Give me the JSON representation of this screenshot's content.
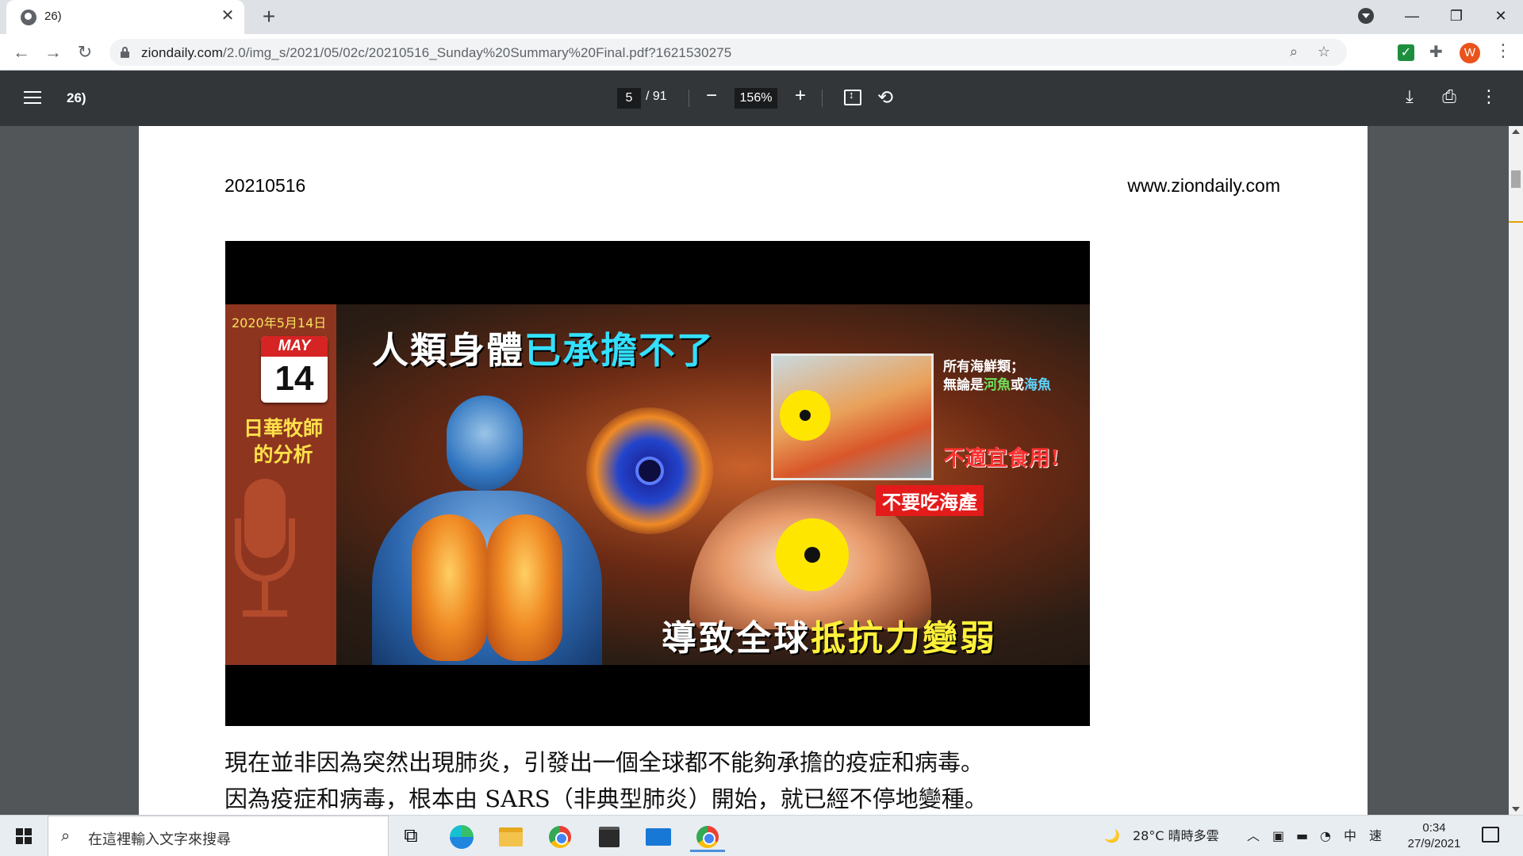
{
  "browser": {
    "tab_title": "26)",
    "tab_close": "✕",
    "new_tab": "+",
    "url_host": "ziondaily.com",
    "url_path": "/2.0/img_s/2021/05/02c/20210516_Sunday%20Summary%20Final.pdf?1621530275",
    "avatar_letter": "W",
    "window_controls": {
      "minimize": "—",
      "restore": "❐",
      "close": "✕"
    }
  },
  "pdf_toolbar": {
    "title": "26)",
    "current_page": "5",
    "total_pages": "/ 91",
    "zoom": "156%",
    "zoom_out": "−",
    "zoom_in": "+"
  },
  "page": {
    "header_date": "20210516",
    "header_site": "www.ziondaily.com",
    "thumbnail": {
      "date": "2020年5月14日",
      "calendar_month": "MAY",
      "calendar_day": "14",
      "brand_line1": "日華牧師",
      "brand_line2": "的分析",
      "title_white": "人類身體",
      "title_cyan": "已承擔不了",
      "seafood_line1": "所有海鮮類；",
      "seafood_line2_a": "無論是",
      "seafood_line2_river": "河魚",
      "seafood_line2_or": "或",
      "seafood_line2_sea": "海魚",
      "warning_unsuitable": "不適宜食用!",
      "warning_no_seafood": "不要吃海產",
      "bottom_white": "導致全球",
      "bottom_yellow": "抵抗力變弱"
    },
    "article_line1": "現在並非因為突然出現肺炎，引發出一個全球都不能夠承擔的疫症和病毒。",
    "article_line2": "因為疫症和病毒，根本由 SARS（非典型肺炎）開始，就已經不停地變種。"
  },
  "taskbar": {
    "search_placeholder": "在這裡輸入文字來搜尋",
    "weather": "28°C  晴時多雲",
    "ime_lang": "中",
    "ime_mode": "速",
    "time": "0:34",
    "date": "27/9/2021"
  },
  "colors": {
    "chrome_tabstrip": "#dee1e6",
    "pdf_toolbar": "#323639",
    "viewer_bg": "#525659",
    "brand_strip": "#8e3520",
    "title_cyan": "#33e0ff",
    "warning_red": "#e31b1b",
    "bottom_yellow": "#fff03a"
  }
}
